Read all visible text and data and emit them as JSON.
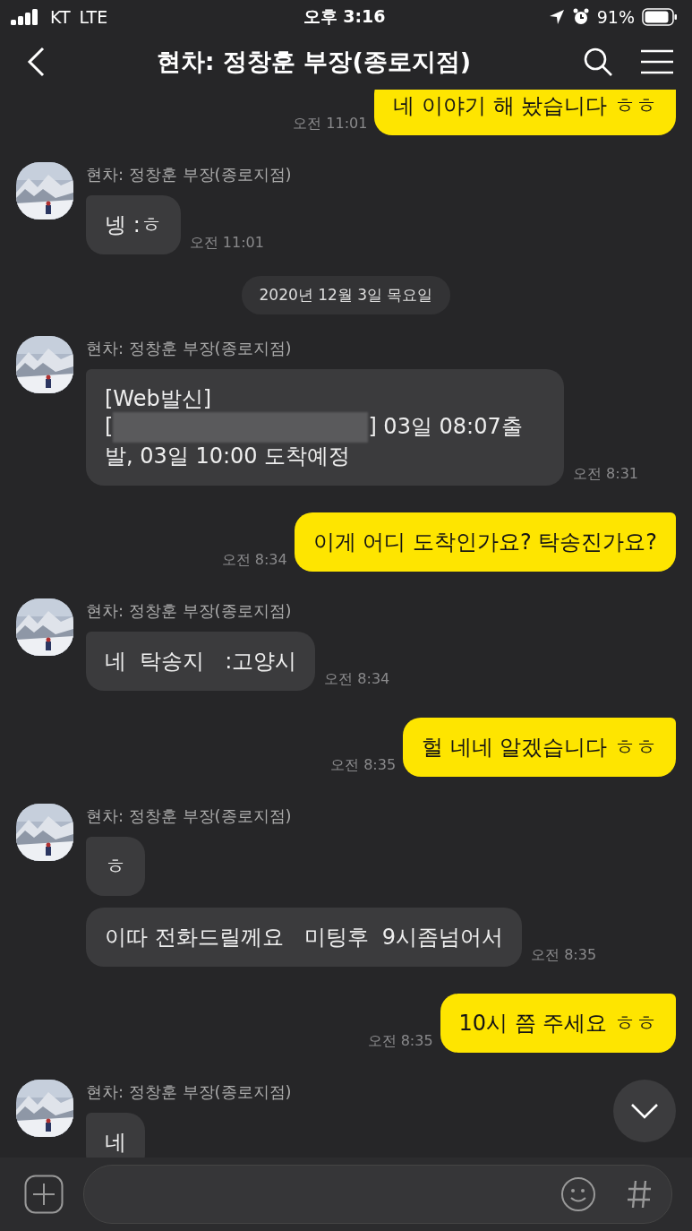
{
  "status_bar": {
    "carrier": "KT",
    "network": "LTE",
    "time": "오후 3:16",
    "battery": "91%"
  },
  "header": {
    "title": "현차: 정창훈 부장(종로지점)"
  },
  "messages": [
    {
      "kind": "sent",
      "text": "네 이야기 해 놨습니다 ㅎㅎ",
      "time": "오전 11:01"
    },
    {
      "kind": "received",
      "sender": "현차: 정창훈 부장(종로지점)",
      "bubbles": [
        {
          "text": "넹 :ㅎ"
        }
      ],
      "time": "오전 11:01"
    },
    {
      "kind": "date",
      "text": "2020년 12월 3일 목요일"
    },
    {
      "kind": "received",
      "sender": "현차: 정창훈 부장(종로지점)",
      "bubbles": [
        {
          "text": "[Web발신]",
          "masked": {
            "before": "[",
            "after": "] 03일 08:07출발, 03일 10:00 도착예정"
          }
        }
      ],
      "time": "오전 8:31"
    },
    {
      "kind": "sent",
      "text": "이게 어디 도착인가요? 탁송진가요?",
      "time": "오전 8:34"
    },
    {
      "kind": "received",
      "sender": "현차: 정창훈 부장(종로지점)",
      "bubbles": [
        {
          "text": "네  탁송지   :고양시"
        }
      ],
      "time": "오전 8:34"
    },
    {
      "kind": "sent",
      "text": "헐 네네 알겠습니다 ㅎㅎ",
      "time": "오전 8:35"
    },
    {
      "kind": "received",
      "sender": "현차: 정창훈 부장(종로지점)",
      "bubbles": [
        {
          "text": "ㅎ"
        },
        {
          "text": "이따 전화드릴께요   미팅후  9시좀넘어서"
        }
      ],
      "time": "오전 8:35"
    },
    {
      "kind": "sent",
      "text": "10시 쯤 주세요 ㅎㅎ",
      "time": "오전 8:35"
    },
    {
      "kind": "received",
      "sender": "현차: 정창훈 부장(종로지점)",
      "bubbles": [
        {
          "text": "네"
        }
      ]
    }
  ]
}
